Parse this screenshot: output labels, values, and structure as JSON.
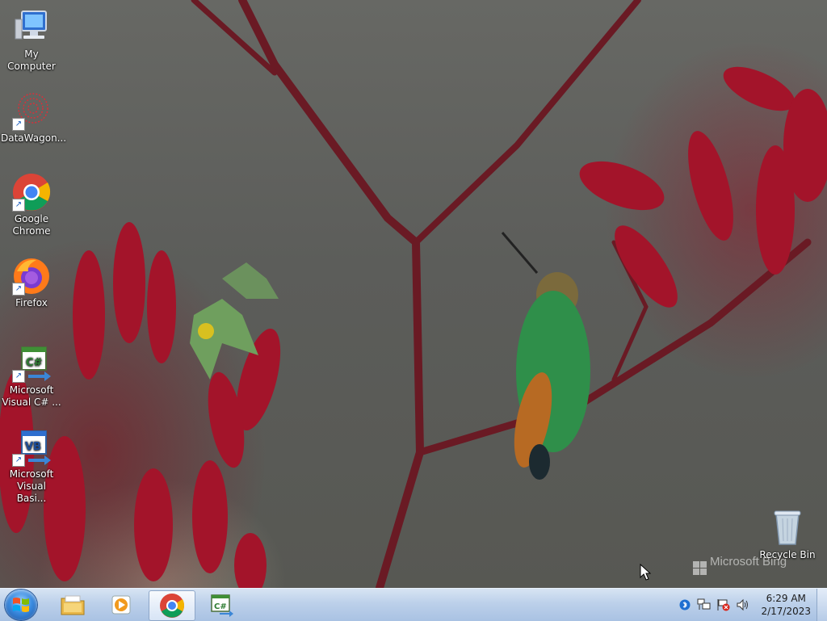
{
  "desktop": {
    "icons": [
      {
        "label": "My Computer",
        "icon": "computer-icon"
      },
      {
        "label": "DataWagon...",
        "icon": "datawagon-icon"
      },
      {
        "label": "Google Chrome",
        "icon": "chrome-icon"
      },
      {
        "label": "Firefox",
        "icon": "firefox-icon"
      },
      {
        "label": "Microsoft Visual C# ...",
        "icon": "visual-csharp-icon"
      },
      {
        "label": "Microsoft Visual Basi...",
        "icon": "visual-basic-icon"
      },
      {
        "label": "Recycle Bin",
        "icon": "recycle-bin-icon"
      }
    ],
    "watermark": "Microsoft Bing"
  },
  "taskbar": {
    "start_icon": "windows-start-icon",
    "pinned": [
      {
        "icon": "file-explorer-icon"
      },
      {
        "icon": "media-player-icon"
      },
      {
        "icon": "chrome-icon",
        "active": true
      },
      {
        "icon": "visual-csharp-icon"
      }
    ],
    "tray_icons": [
      "bluetooth-icon",
      "network-icon",
      "action-center-flag-icon",
      "volume-icon"
    ],
    "clock": {
      "time": "6:29 AM",
      "date": "2/17/2023"
    }
  },
  "colors": {
    "taskbar_top": "#d7e4f3",
    "taskbar_bottom": "#a9c2e3",
    "desktop_background": "#5f605c",
    "flower_red": "#a3142a"
  }
}
